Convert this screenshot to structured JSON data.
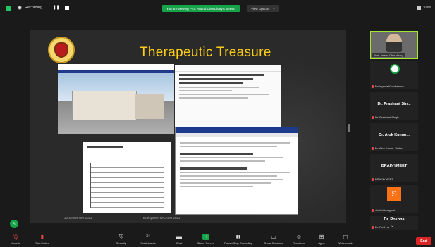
{
  "topbar": {
    "recording_label": "Recording...",
    "viewing_banner": "You are viewing Prof. Anand Choudhary's screen",
    "view_options_label": "View Options",
    "view_label": "View"
  },
  "slide": {
    "title": "Therapeutic Treasure",
    "footer_date": "30 September 2023",
    "footer_conference": "Brainymeet IVCASM 2023"
  },
  "participants": [
    {
      "name": "Prof. Anand Choudhary",
      "label": "Prof. Anand Choudhary"
    },
    {
      "name": "",
      "label": "BrainymeetConference"
    },
    {
      "name": "Dr. Prashant Sin...",
      "label": "Dr. Prashant Singh"
    },
    {
      "name": "Dr. Alok Kumar...",
      "label": "Dr. Alok Kumar Yadav"
    },
    {
      "name": "BRAINYMEET",
      "label": "BRAINYMEET"
    },
    {
      "name": "S",
      "label": "shubhi bhagwat"
    },
    {
      "name": "Dr. Roshna",
      "label": "Dr. Roshna"
    }
  ],
  "toolbar": {
    "unmute": "Unmute",
    "start_video": "Start Video",
    "security": "Security",
    "participants": "Participants",
    "participants_count": "34",
    "chat": "Chat",
    "share_screen": "Share Screen",
    "pause_recording": "Pause/Stop Recording",
    "show_captions": "Show Captions",
    "reactions": "Reactions",
    "apps": "Apps",
    "whiteboards": "Whiteboards",
    "end": "End"
  },
  "colors": {
    "accent_green": "#16a34a",
    "title_yellow": "#facc15",
    "end_red": "#dc2626"
  }
}
